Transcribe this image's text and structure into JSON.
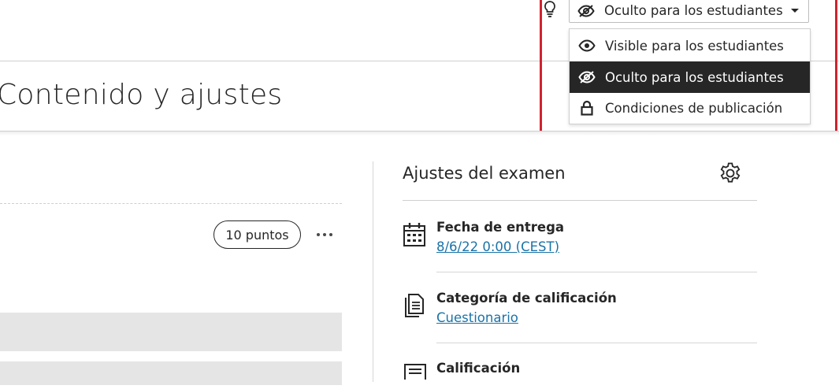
{
  "visibility": {
    "current": "Oculto para los estudiantes",
    "options": [
      {
        "label": "Visible para los estudiantes",
        "icon": "eye-icon"
      },
      {
        "label": "Oculto para los estudiantes",
        "icon": "eye-slash-icon",
        "selected": true
      },
      {
        "label": "Condiciones de publicación",
        "icon": "lock-icon"
      }
    ]
  },
  "page": {
    "title": "Contenido y ajustes"
  },
  "question": {
    "points": "10 puntos"
  },
  "settings": {
    "title": "Ajustes del examen",
    "items": [
      {
        "title": "Fecha de entrega",
        "value": "8/6/22 0:00 (CEST)",
        "icon": "calendar-icon"
      },
      {
        "title": "Categoría de calificación",
        "value": "Cuestionario",
        "icon": "document-icon"
      },
      {
        "title": "Calificación",
        "icon": "list-icon"
      }
    ]
  },
  "colors": {
    "highlight": "#d0232f",
    "selected_bg": "#262626",
    "link": "#1a73a8"
  }
}
